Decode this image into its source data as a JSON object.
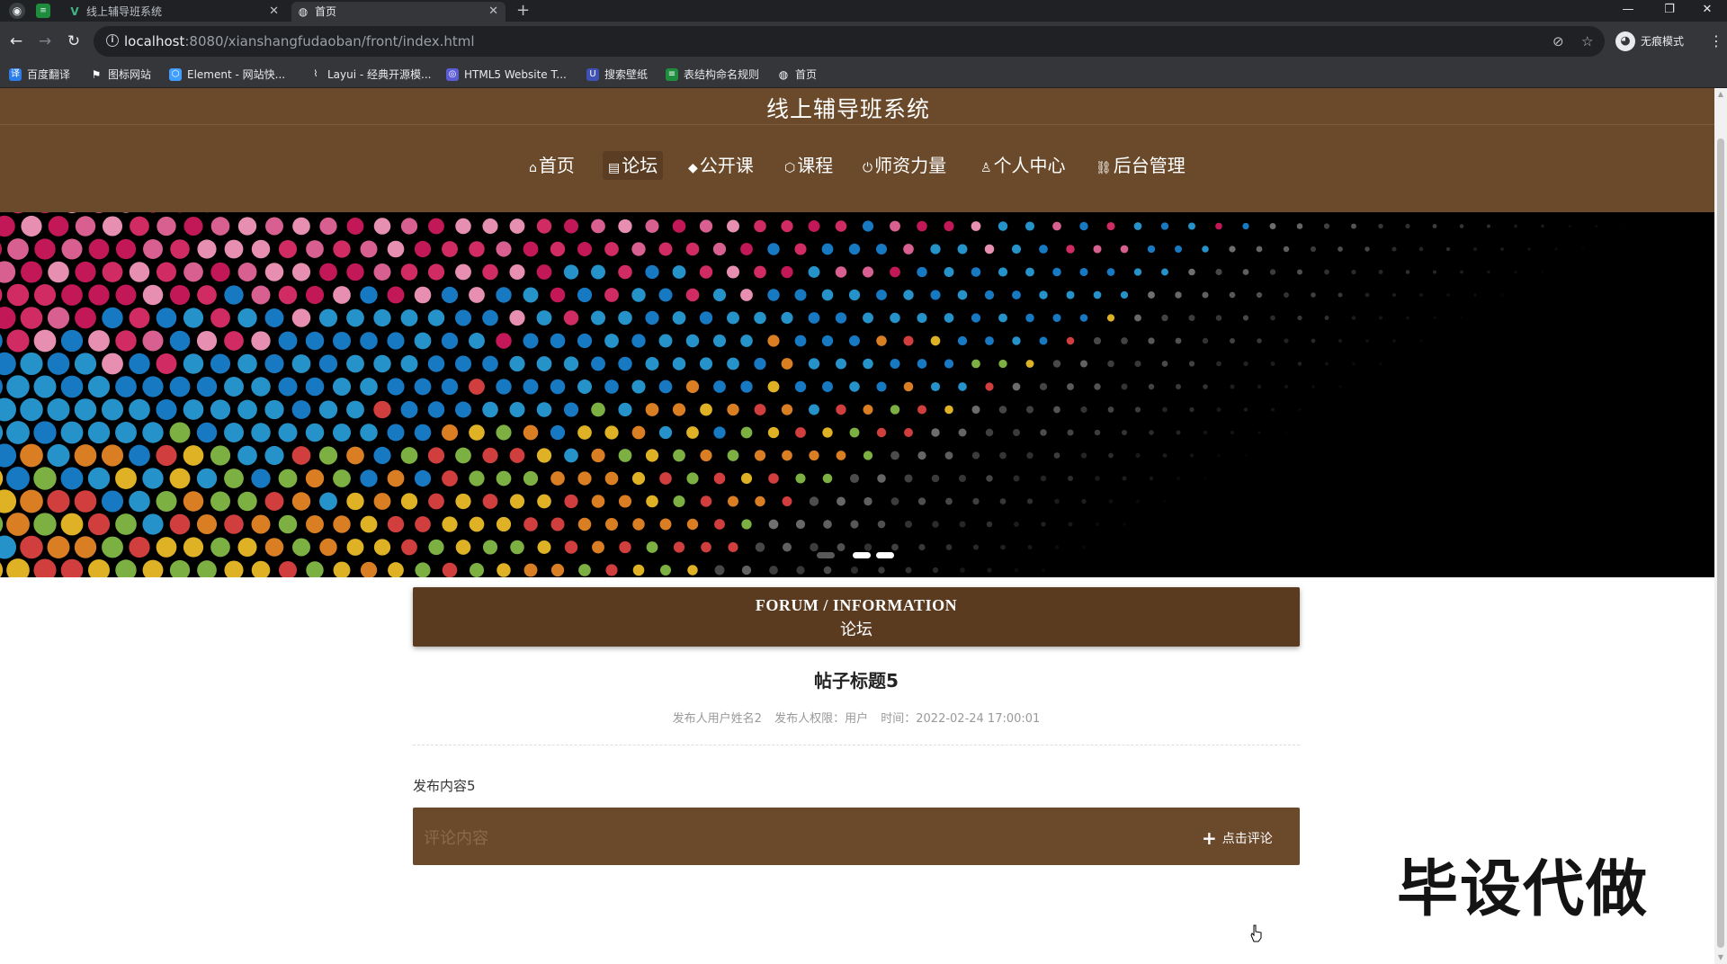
{
  "browser": {
    "tabs": [
      {
        "label": "线上辅导班系统",
        "active": false
      },
      {
        "label": "首页",
        "active": true
      }
    ],
    "url": {
      "host": "localhost",
      "path": ":8080/xianshangfudaoban/front/index.html"
    },
    "profile_label": "无痕模式",
    "bookmarks": [
      "百度翻译",
      "图标网站",
      "Element - 网站快...",
      "Layui - 经典开源模...",
      "HTML5 Website T...",
      "搜索壁纸",
      "表结构命名规则",
      "首页"
    ]
  },
  "site": {
    "title": "线上辅导班系统",
    "menu": [
      {
        "label": "首页",
        "icon": "home-icon",
        "glyph": "⌂"
      },
      {
        "label": "论坛",
        "icon": "forum-icon",
        "glyph": "▤"
      },
      {
        "label": "公开课",
        "icon": "graduation-cap-icon",
        "glyph": "◆"
      },
      {
        "label": "课程",
        "icon": "cube-icon",
        "glyph": "⬡"
      },
      {
        "label": "师资力量",
        "icon": "power-icon",
        "glyph": "⏻"
      },
      {
        "label": "个人中心",
        "icon": "user-icon",
        "glyph": "♙"
      },
      {
        "label": "后台管理",
        "icon": "link-icon",
        "glyph": "⛓"
      }
    ],
    "active_menu": "论坛"
  },
  "section": {
    "english": "FORUM / INFORMATION",
    "chinese": "论坛"
  },
  "post": {
    "title": "帖子标题5",
    "author": "发布人用户姓名2",
    "role": "发布人权限：用户",
    "time": "时间：2022-02-24 17:00:01",
    "content": "发布内容5"
  },
  "comment": {
    "placeholder": "评论内容",
    "button_label": "点击评论"
  },
  "watermark": "毕设代做",
  "colors": {
    "header_brown": "#6b4a2b",
    "section_brown": "#5a3b20"
  }
}
